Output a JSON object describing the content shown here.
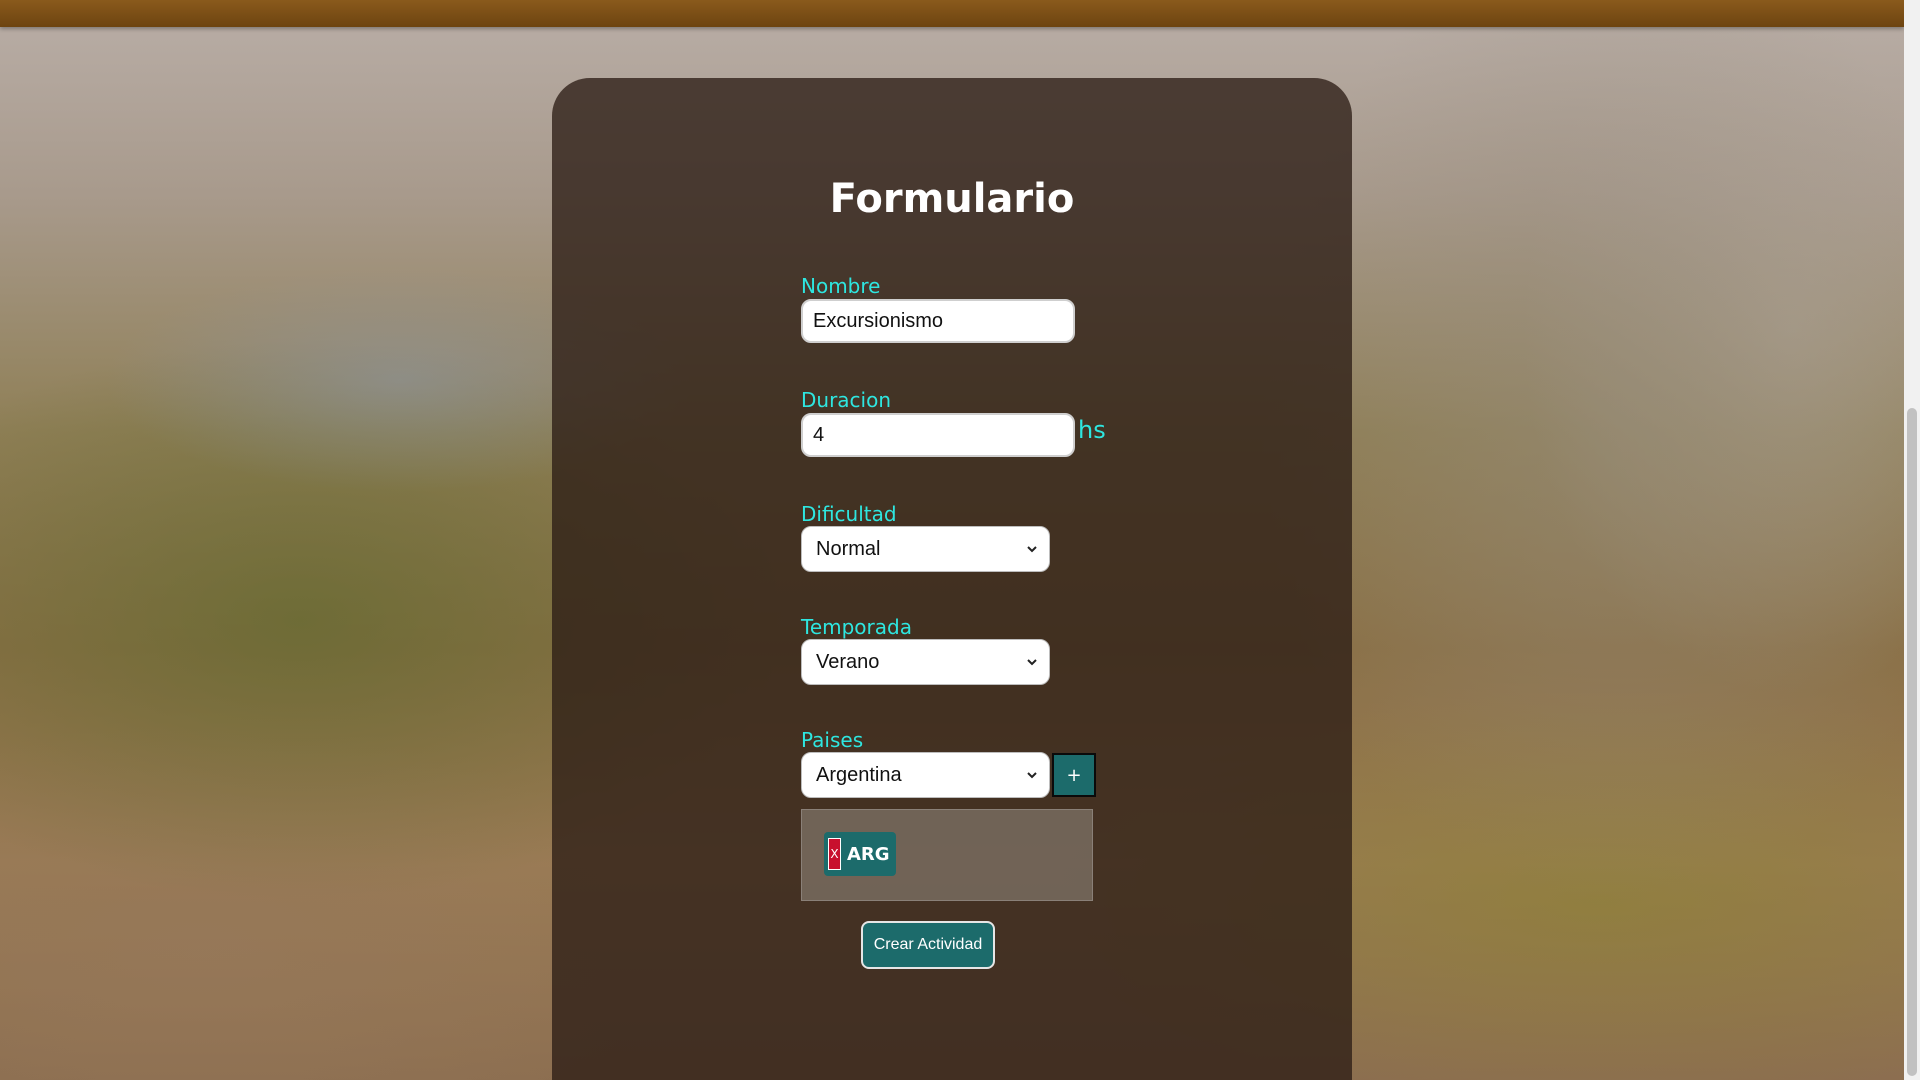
{
  "form": {
    "title": "Formulario",
    "nombre": {
      "label": "Nombre",
      "value": "Excursionismo"
    },
    "duracion": {
      "label": "Duracion",
      "value": "4",
      "unit": "hs"
    },
    "dificultad": {
      "label": "Dificultad",
      "selected": "Normal"
    },
    "temporada": {
      "label": "Temporada",
      "selected": "Verano"
    },
    "paises": {
      "label": "Paises",
      "selected": "Argentina",
      "add_label": "+",
      "chips": [
        {
          "remove_label": "X",
          "code": "ARG"
        }
      ]
    },
    "submit_label": "Crear Actividad"
  },
  "colors": {
    "accent_label": "#2ee6e0",
    "button_teal": "#1c6b6b",
    "topbar_brown": "#7a4e16",
    "remove_red": "#c8102e"
  },
  "icons": {
    "select_arrow": "chevron-down-icon"
  }
}
